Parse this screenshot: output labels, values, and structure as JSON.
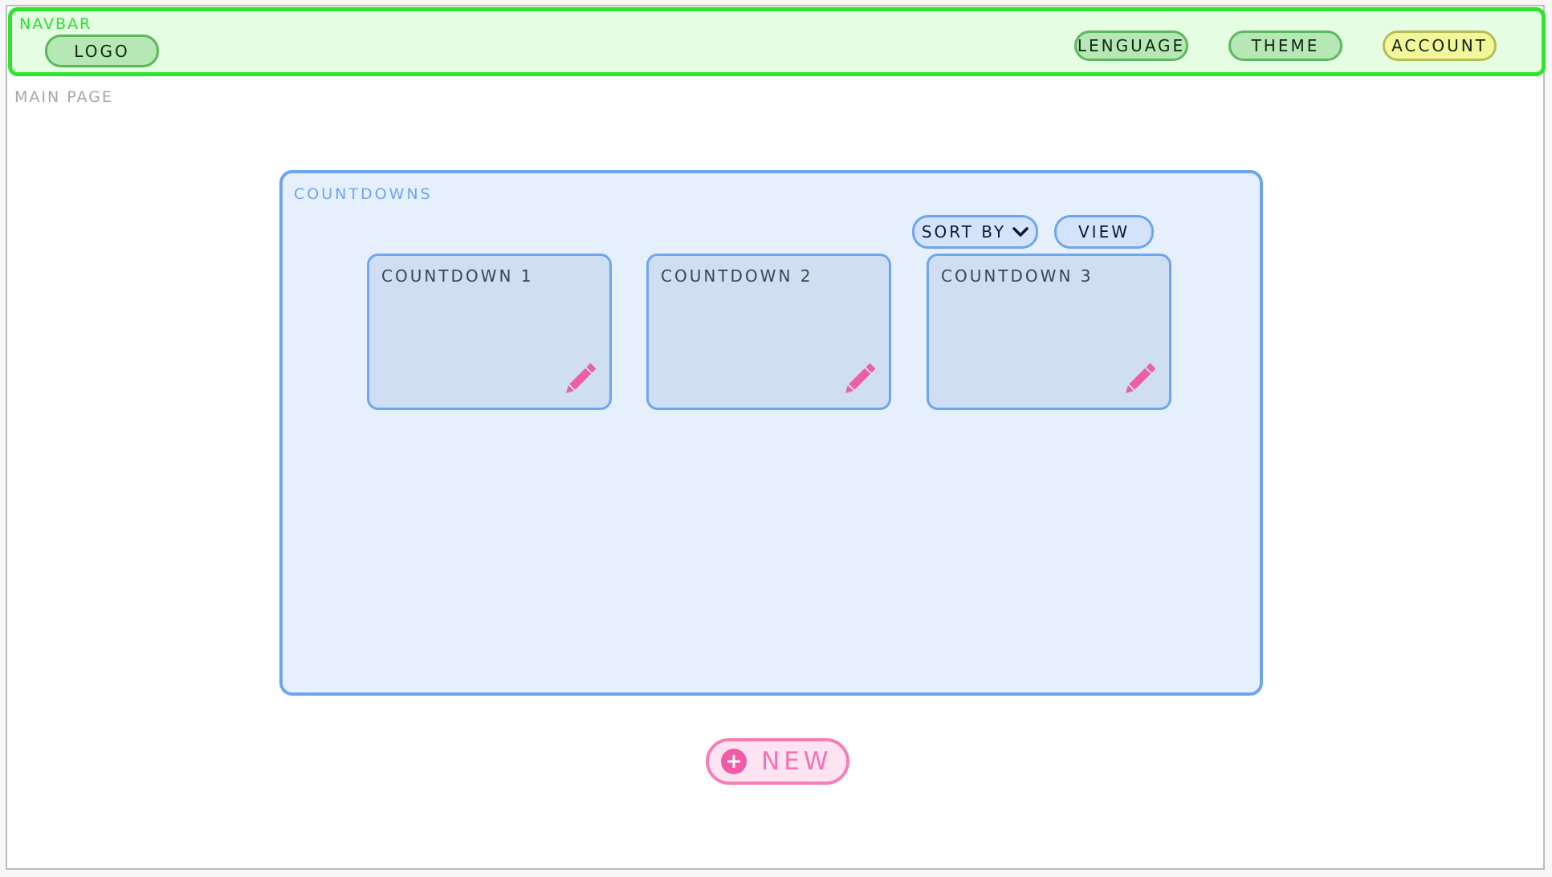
{
  "navbar": {
    "label": "NAVBAR",
    "logo": "LOGO",
    "language": "LENGUAGE",
    "theme": "THEME",
    "account": "ACCOUNT"
  },
  "main": {
    "label": "MAIN PAGE"
  },
  "countdowns": {
    "label": "COUNTDOWNS",
    "sort_by": "SORT BY",
    "view": "VIEW",
    "items": [
      {
        "title": "COUNTDOWN 1",
        "icon": "pencil-icon"
      },
      {
        "title": "COUNTDOWN 2",
        "icon": "pencil-icon"
      },
      {
        "title": "COUNTDOWN 3",
        "icon": "pencil-icon"
      }
    ]
  },
  "new_button": {
    "label": "NEW",
    "icon": "plus-circle-icon"
  },
  "colors": {
    "navbar_border": "#2fe42c",
    "navbar_bg": "#e4fde3",
    "panel_border": "#6ea6ee",
    "panel_bg": "#e6f0fd",
    "accent_pink": "#f472b6",
    "account_bg": "#f3f79c"
  }
}
